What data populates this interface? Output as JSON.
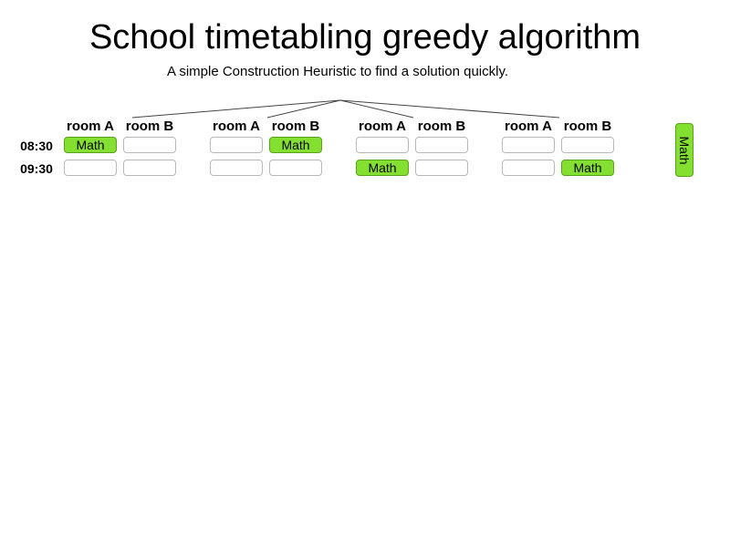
{
  "title": "School timetabling greedy algorithm",
  "subtitle": "A simple Construction Heuristic to find a solution quickly.",
  "timeslots": [
    "08:30",
    "09:30"
  ],
  "rooms": [
    "room A",
    "room B"
  ],
  "states": [
    {
      "cells": [
        [
          "Math",
          ""
        ],
        [
          "",
          ""
        ]
      ]
    },
    {
      "cells": [
        [
          "",
          "Math"
        ],
        [
          "",
          ""
        ]
      ]
    },
    {
      "cells": [
        [
          "",
          ""
        ],
        [
          "Math",
          ""
        ]
      ]
    },
    {
      "cells": [
        [
          "",
          ""
        ],
        [
          "",
          "Math"
        ]
      ]
    }
  ],
  "unassigned_lesson": "Math",
  "colors": {
    "lesson_fill": "#84e030",
    "lesson_border": "#5aa21c",
    "cell_border": "#b8b8b8"
  }
}
